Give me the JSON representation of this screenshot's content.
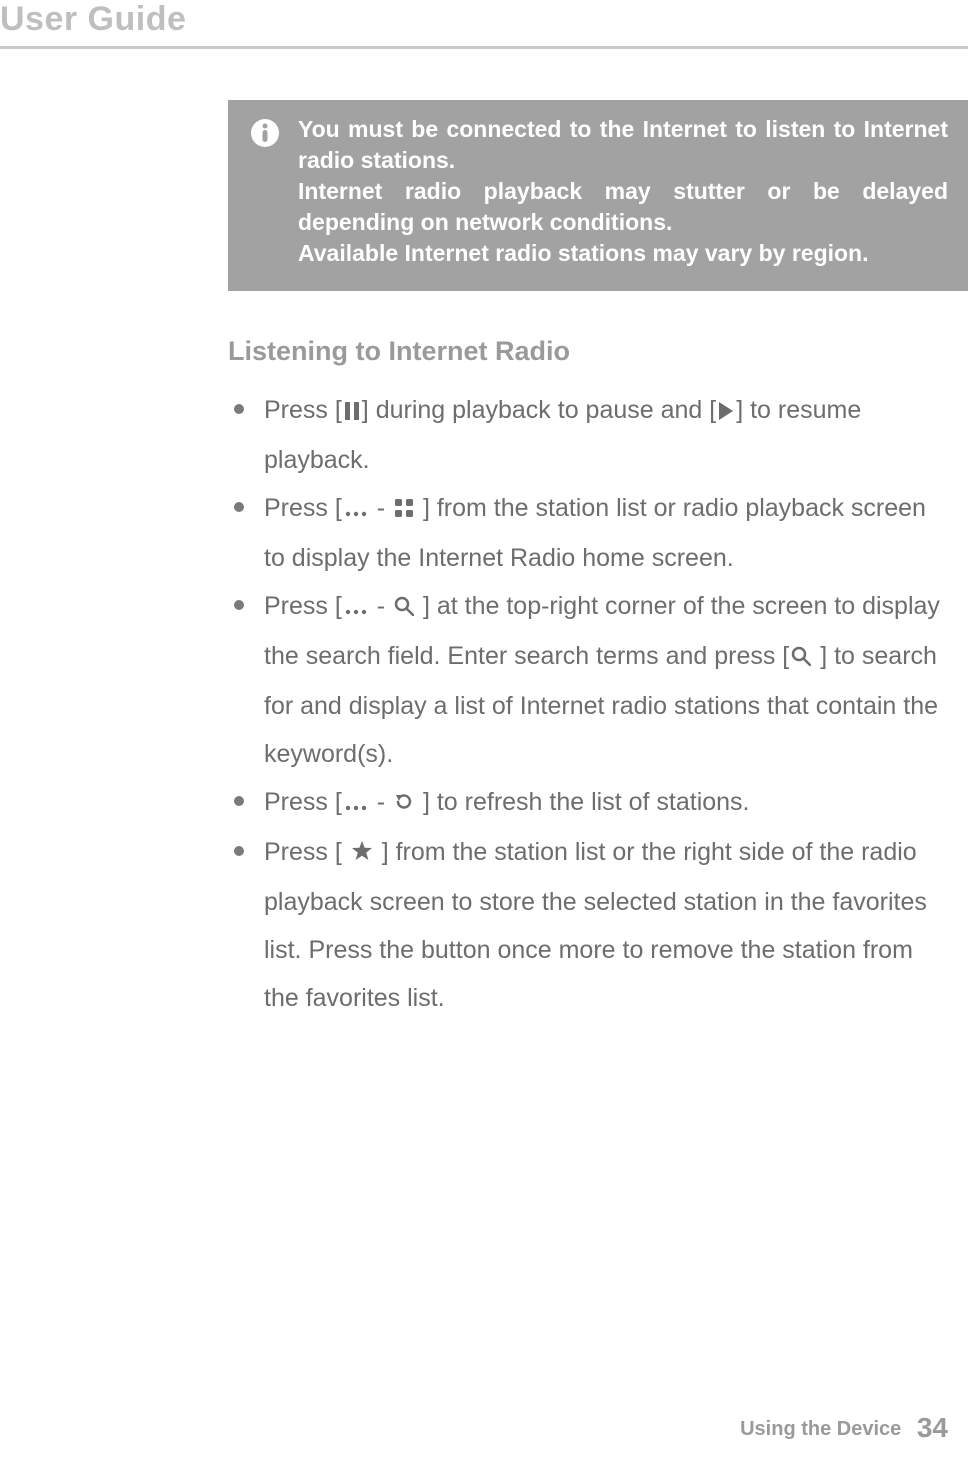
{
  "header": {
    "title": "User Guide"
  },
  "callout": {
    "line1": "You must be connected to the Internet to listen to Internet radio stations.",
    "line2": "Internet radio playback may stutter or be delayed depending on network conditions.",
    "line3": "Available Internet radio stations may vary by region."
  },
  "section": {
    "heading": "Listening to Internet Radio"
  },
  "bullets": {
    "b1a": "Press [",
    "b1b": "] during playback to pause and [",
    "b1c": "] to resume playback.",
    "b2a": "Press [",
    "b2b": " - ",
    "b2c": " ] from the station list or radio playback screen to display the Internet Radio home screen.",
    "b3a": "Press [",
    "b3b": " - ",
    "b3c": " ] at the top-right corner of the screen to display the search field. Enter search terms and press [",
    "b3d": " ] to search for and display a list of Internet radio stations that contain the keyword(s).",
    "b4a": "Press [",
    "b4b": " - ",
    "b4c": " ] to refresh the list of stations.",
    "b5a": "Press [ ",
    "b5b": " ] from the station list or the right side of the radio playback screen to store the selected station in the favorites list. Press the button once more to remove the station from the favorites list."
  },
  "footer": {
    "section": "Using the Device",
    "page": "34"
  }
}
